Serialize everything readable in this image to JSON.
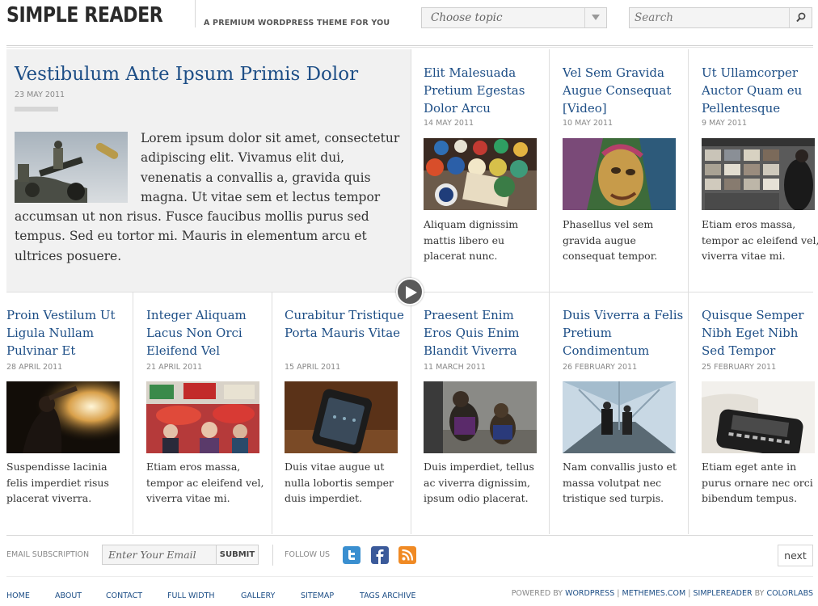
{
  "header": {
    "logo": "SIMPLE READER",
    "tagline": "A PREMIUM WORDPRESS THEME FOR YOU",
    "topic_select": "Choose topic",
    "search_placeholder": "Search"
  },
  "featured": {
    "title": "Vestibulum Ante Ipsum Primis Dolor",
    "date": "23 MAY 2011",
    "excerpt": "Lorem ipsum dolor sit amet, consectetur adipiscing elit. Vivamus elit dui, venenatis a convallis a, gravida quis magna. Ut vitae sem et lectus tempor accumsan ut non risus. Fusce faucibus mollis purus sed tempus. Sed eu tortor mi. Mauris in elementum arcu et ultrices posuere."
  },
  "posts_row1": [
    {
      "title": "Elit Malesuada Pretium Egestas Dolor Arcu",
      "date": "14 MAY 2011",
      "excerpt": "Aliquam dignissim mattis libero eu placerat nunc."
    },
    {
      "title": "Vel Sem Gravida Augue Consequat [Video]",
      "date": "10 MAY 2011",
      "excerpt": "Phasellus vel sem gravida augue consequat tempor."
    },
    {
      "title": "Ut Ullamcorper Auctor Quam eu Pellentesque",
      "date": "9 MAY 2011",
      "excerpt": "Etiam eros massa, tempor ac eleifend vel, viverra vitae mi."
    }
  ],
  "posts_row2": [
    {
      "title": "Proin Vestilum Ut Ligula Nullam Pulvinar Et",
      "date": "28 APRIL 2011",
      "excerpt": "Suspendisse lacinia felis imperdiet risus placerat viverra."
    },
    {
      "title": "Integer Aliquam Lacus Non Orci Eleifend Vel",
      "date": "21 APRIL 2011",
      "excerpt": "Etiam eros massa, tempor ac eleifend vel, viverra vitae mi."
    },
    {
      "title": "Curabitur Tristique Porta Mauris Vitae",
      "date": "15 APRIL 2011",
      "excerpt": "Duis vitae augue ut nulla lobortis semper duis imperdiet."
    },
    {
      "title": "Praesent Enim Eros Quis Enim Blandit Viverra",
      "date": "11 MARCH 2011",
      "excerpt": "Duis imperdiet, tellus ac viverra dignissim, ipsum odio placerat."
    },
    {
      "title": "Duis Viverra a Felis Pretium Condimentum",
      "date": "26 FEBRUARY 2011",
      "excerpt": "Nam convallis justo et massa volutpat nec tristique sed turpis."
    },
    {
      "title": "Quisque Semper Nibh Eget Nibh Sed Tempor",
      "date": "25 FEBRUARY 2011",
      "excerpt": "Etiam eget ante in purus ornare nec orci bibendum tempus."
    }
  ],
  "footer": {
    "email_label": "EMAIL SUBSCRIPTION",
    "email_placeholder": "Enter Your Email",
    "submit_label": "SUBMIT",
    "follow_label": "FOLLOW US",
    "next_label": "next",
    "nav": [
      "HOME",
      "ABOUT",
      "CONTACT",
      "FULL WIDTH",
      "GALLERY",
      "SITEMAP",
      "TAGS ARCHIVE"
    ],
    "credits": {
      "powered_by": "POWERED BY",
      "wordpress": "WORDPRESS",
      "sep1": "|",
      "methemes": "METHEMES.COM",
      "sep2": "|",
      "simplereader": "SIMPLEREADER",
      "by": "BY",
      "colorlabs": "COLORLABS"
    }
  },
  "colors": {
    "link": "#1d4e86",
    "featured_bg": "#f1f1f1",
    "twitter": "#3a8fd0",
    "facebook": "#3b5a9a",
    "rss": "#f08a24"
  }
}
